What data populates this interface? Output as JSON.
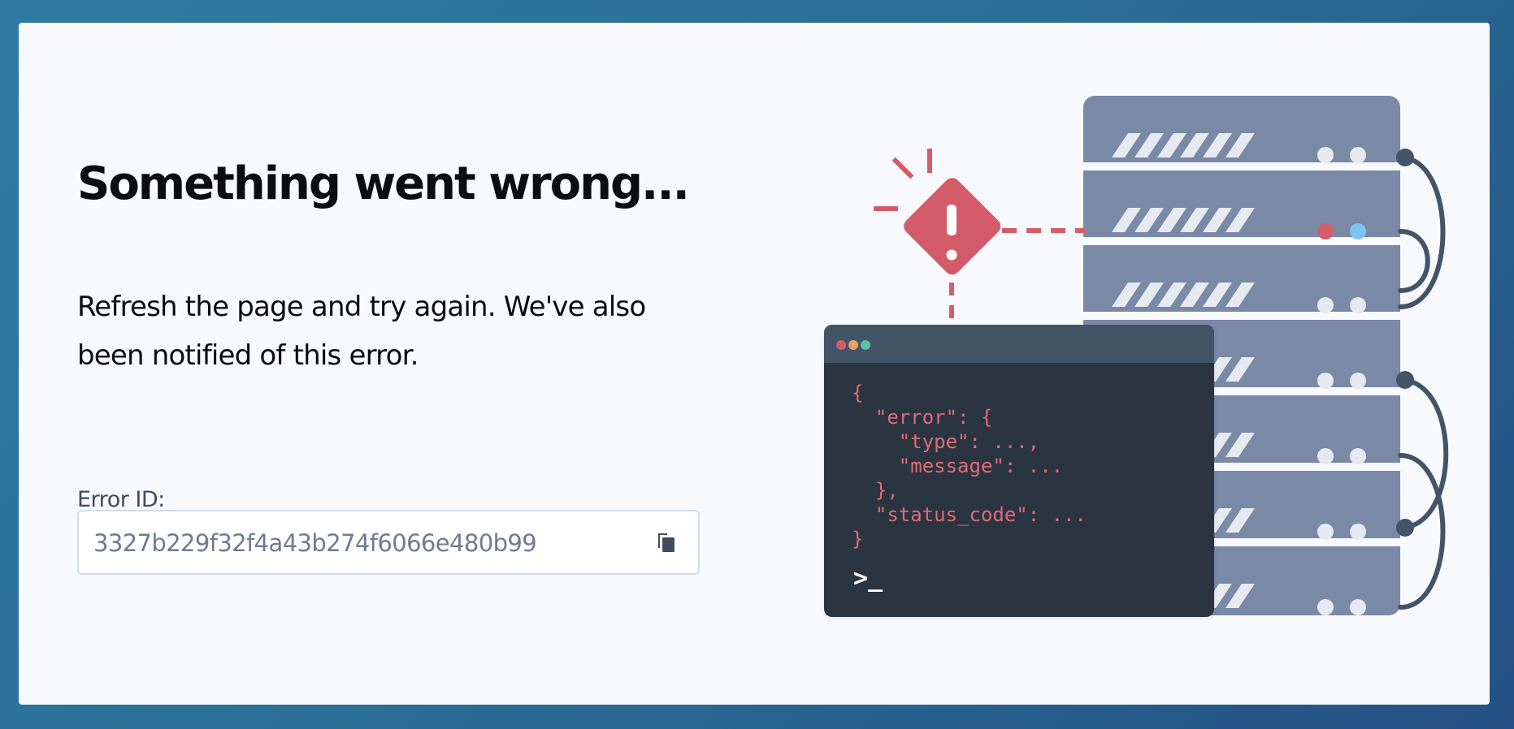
{
  "error_page": {
    "title": "Something went wrong...",
    "message": "Refresh the page and try again. We've also been notified of this error.",
    "error_id_label": "Error ID:",
    "error_id": "3327b229f32f4a43b274f6066e480b99"
  },
  "illustration": {
    "terminal_code": "{\n  \"error\": {\n    \"type\": ...,\n    \"message\": ...\n  },\n  \"status_code\": ...\n}",
    "prompt": ">_"
  },
  "icons": {
    "copy": "copy-icon",
    "warning": "warning-icon",
    "server": "server-rack-icon"
  },
  "colors": {
    "background_gradient_start": "#2f7ba0",
    "background_gradient_end": "#235183",
    "card": "#f7f9fc",
    "alert_red": "#d45c6a",
    "server_slate": "#7a89a6",
    "terminal_dark": "#2b3441",
    "terminal_header": "#445467"
  }
}
